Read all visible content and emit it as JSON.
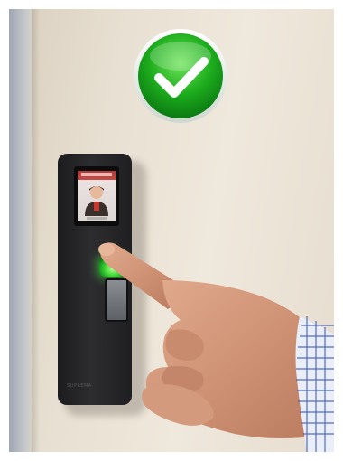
{
  "scene": {
    "badge": {
      "icon": "check-mark-icon",
      "color": "#1aa31a"
    },
    "device": {
      "icon": "fingerprint-terminal",
      "status_led": "#3fdc3a",
      "brand": "SUPREMA"
    }
  }
}
